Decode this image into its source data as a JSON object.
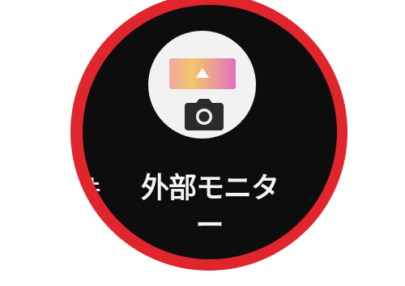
{
  "app": {
    "label_line1": "外部モニタ",
    "label_line2": "ー",
    "neighbor_label_fragment": "件",
    "icon_name": "external-monitor-camera-icon"
  },
  "colors": {
    "ring": "#e0252c",
    "background": "#0d0d0d",
    "icon_bg": "#f2f2f2",
    "label": "#f5f5f5"
  }
}
